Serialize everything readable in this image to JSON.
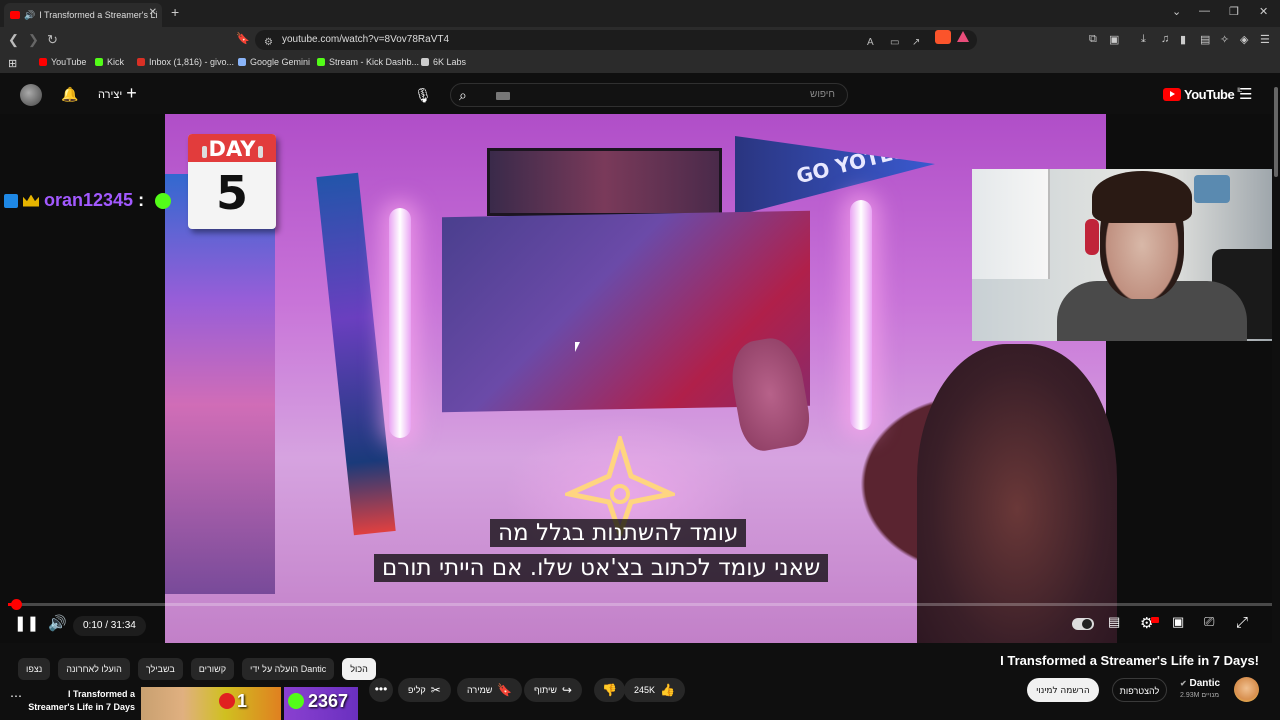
{
  "browser": {
    "tab_title": "I Transformed a Streamer's Li",
    "url": "youtube.com/watch?v=8Vov78RaVT4",
    "bookmarks": [
      {
        "label": "YouTube",
        "color": "#ff0000"
      },
      {
        "label": "Kick",
        "color": "#53fc18"
      },
      {
        "label": "Inbox (1,816) - givo...",
        "color": "#d93025"
      },
      {
        "label": "Google Gemini",
        "color": "#8ab4f8"
      },
      {
        "label": "Stream - Kick Dashb...",
        "color": "#53fc18"
      },
      {
        "label": "6K Labs",
        "color": "#cccccc"
      }
    ]
  },
  "header": {
    "create_label": "יצירה",
    "search_placeholder": "חיפוש",
    "logo_text": "YouTube",
    "country_code": "IL"
  },
  "player": {
    "calendar_label": "DAY",
    "calendar_day": "5",
    "chat_user": "oran12345",
    "chat_colon": ":",
    "subtitle_line1": "עומד להשתנות בגלל מה",
    "subtitle_line2": "שאני עומד לכתוב בצ'אט שלו.  אם הייתי תורם",
    "time": "0:10 / 31:34",
    "progress_fraction": 0.0053,
    "accent_color": "#ff0000"
  },
  "video": {
    "title": "I Transformed a Streamer's Life in 7 Days!",
    "channel": "Dantic",
    "subscribers": "2.93M מנויים",
    "join_label": "להצטרפות",
    "subscribe_label": "הרשמה למינוי",
    "likes": "245K",
    "share_label": "שיתוף",
    "save_label": "שמירה",
    "clip_label": "קליפ"
  },
  "chips": [
    "נצפו",
    "הועלו לאחרונה",
    "בשבילך",
    "קשורים",
    "הועלה על ידי Dantic",
    "הכול"
  ],
  "upnext": {
    "title": "I Transformed a Streamer's Life in 7 Days",
    "thumb1_number": "1",
    "thumb2_number": "2367"
  }
}
